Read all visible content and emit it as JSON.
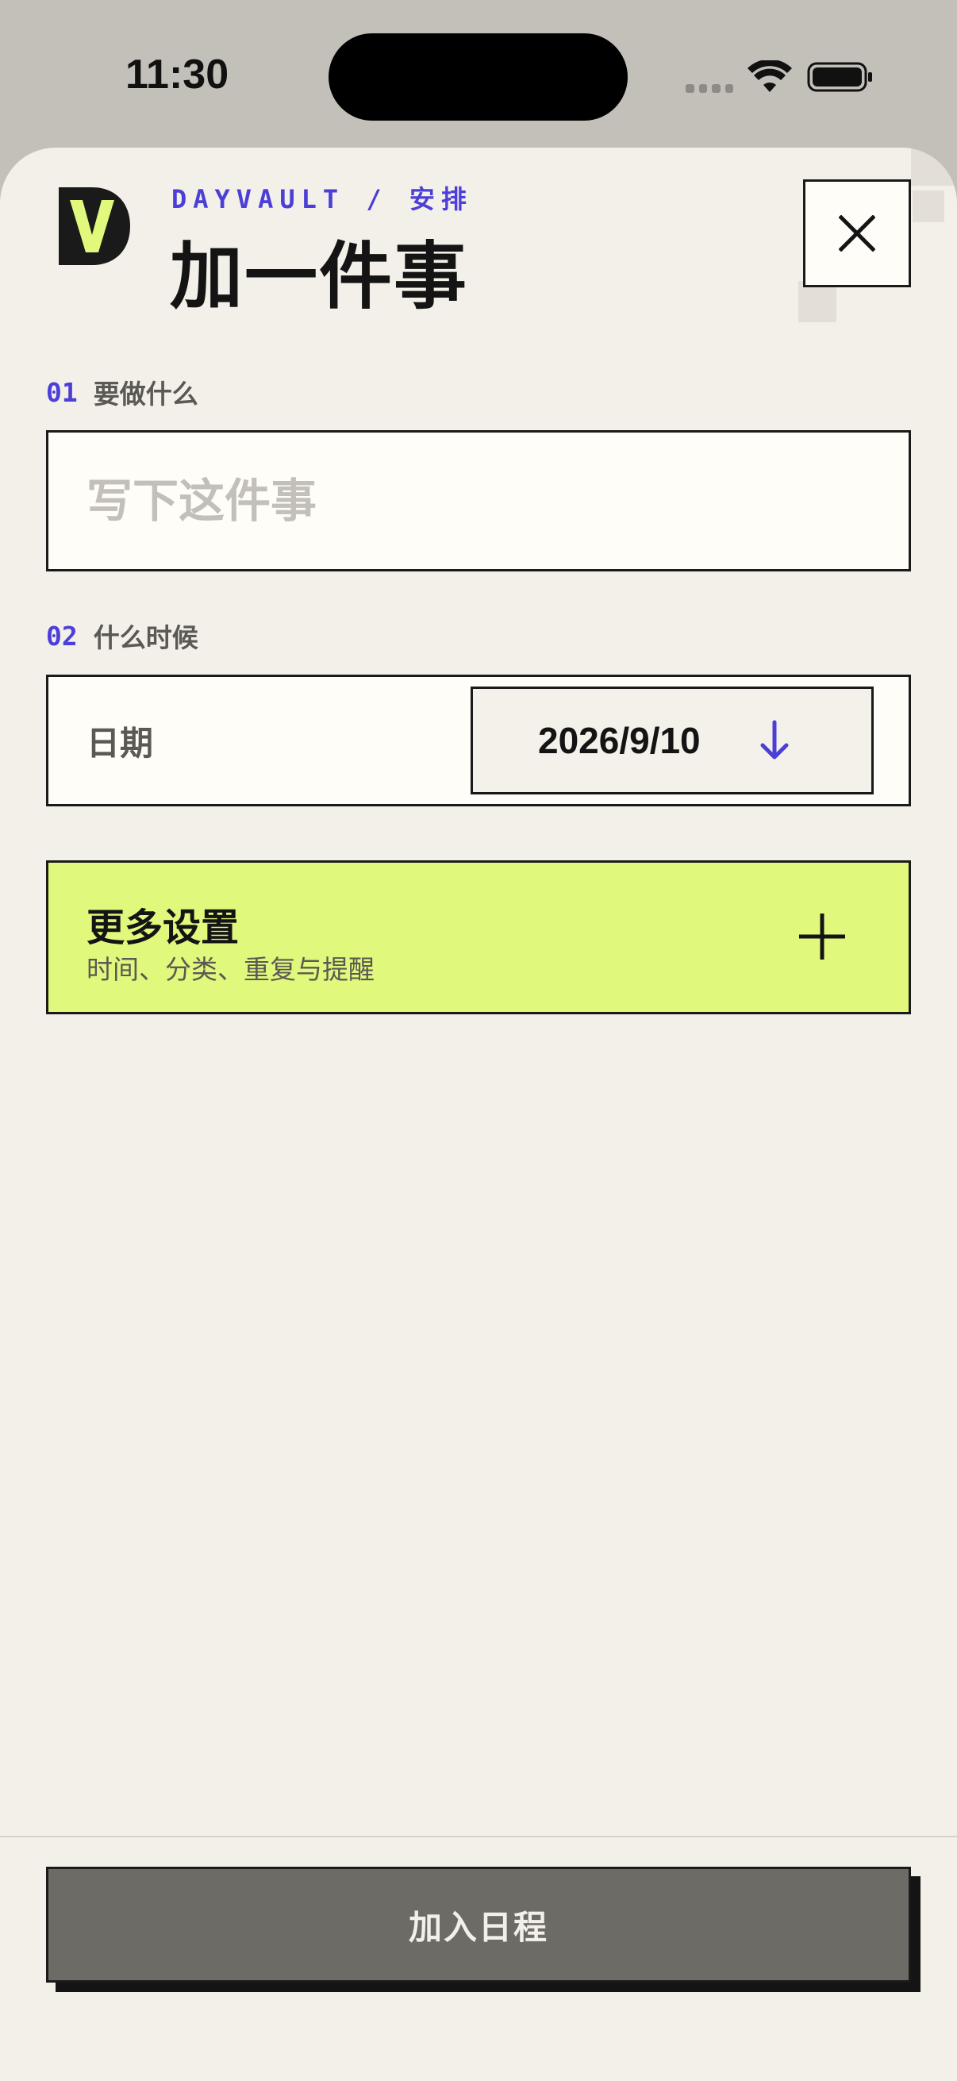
{
  "status_bar": {
    "time": "11:30"
  },
  "header": {
    "eyebrow": "DAYVAULT / 安排",
    "title": "加一件事",
    "logo_letter": "V",
    "close_icon": "close-icon"
  },
  "fields": {
    "what": {
      "number": "01",
      "label": "要做什么",
      "value": "",
      "placeholder": "写下这件事"
    },
    "when": {
      "number": "02",
      "label": "什么时候",
      "date_label": "日期",
      "date_value": "2026/9/10",
      "arrow_icon": "arrow-down-icon"
    }
  },
  "more_settings": {
    "title": "更多设置",
    "subtitle": "时间、分类、重复与提醒",
    "icon": "plus-icon"
  },
  "footer": {
    "submit_label": "加入日程"
  },
  "colors": {
    "accent": "#4b3fd8",
    "highlight": "#e0f87c",
    "background": "#f3efe9",
    "ink": "#141414",
    "button_disabled": "#6d6b65"
  }
}
